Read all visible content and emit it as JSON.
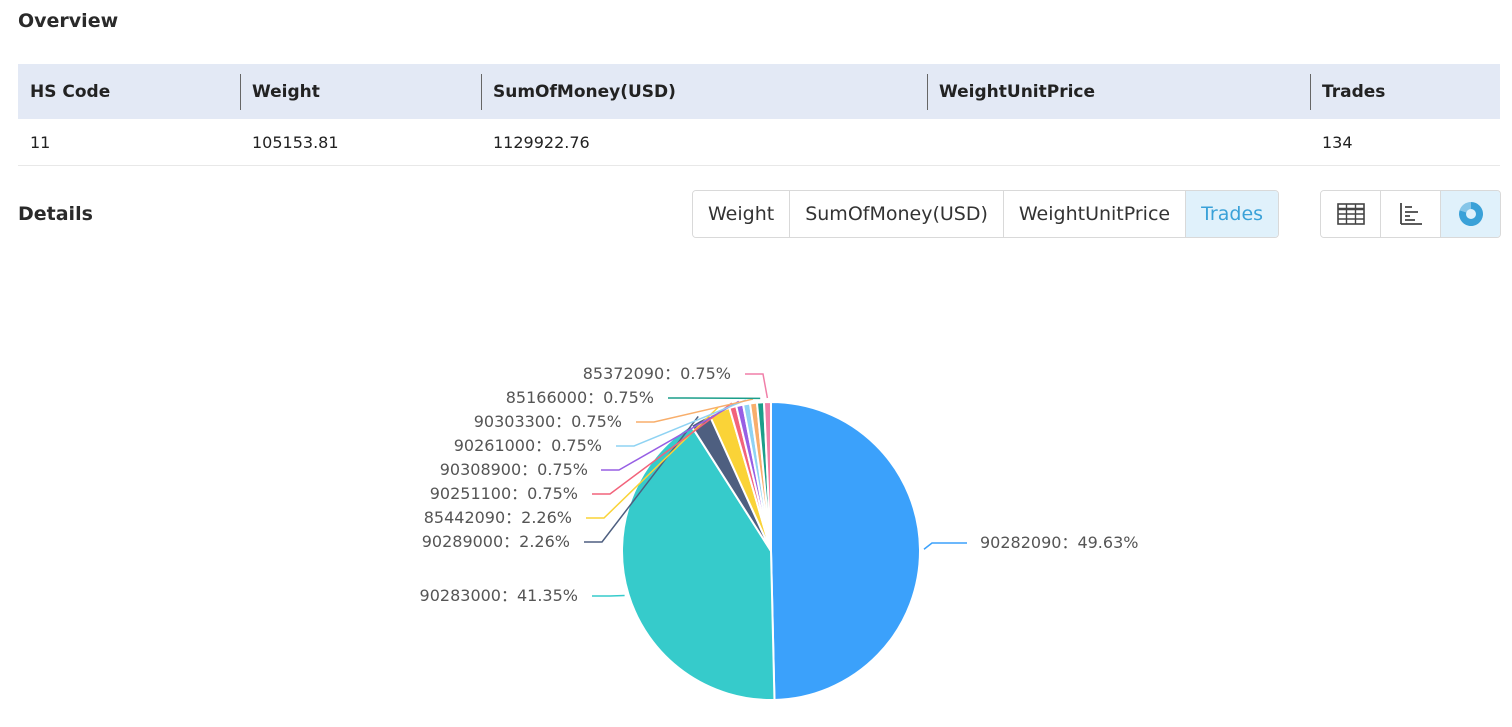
{
  "overview": {
    "title": "Overview",
    "columns": [
      "HS Code",
      "Weight",
      "SumOfMoney(USD)",
      "WeightUnitPrice",
      "Trades"
    ],
    "row": [
      "11",
      "105153.81",
      "1129922.76",
      "",
      "134"
    ]
  },
  "details": {
    "title": "Details",
    "metric_tabs": [
      "Weight",
      "SumOfMoney(USD)",
      "WeightUnitPrice",
      "Trades"
    ],
    "active_tab": "Trades",
    "view_icons": [
      "table-icon",
      "bar-chart-icon",
      "pie-chart-icon"
    ],
    "active_view": "pie-chart-icon"
  },
  "colors": {
    "header_bg": "#e3e9f5",
    "accent": "#3aa1d8"
  },
  "chart_data": {
    "type": "pie",
    "label_separator": "：",
    "slices": [
      {
        "label": "90282090",
        "value": 49.63,
        "display": "49.63%",
        "color": "#3ba1fb"
      },
      {
        "label": "90283000",
        "value": 41.35,
        "display": "41.35%",
        "color": "#36cbcb"
      },
      {
        "label": "90289000",
        "value": 2.26,
        "display": "2.26%",
        "color": "#4e5f80"
      },
      {
        "label": "85442090",
        "value": 2.26,
        "display": "2.26%",
        "color": "#fad337"
      },
      {
        "label": "90251100",
        "value": 0.75,
        "display": "0.75%",
        "color": "#f2637b"
      },
      {
        "label": "90308900",
        "value": 0.75,
        "display": "0.75%",
        "color": "#975fe4"
      },
      {
        "label": "90261000",
        "value": 0.75,
        "display": "0.75%",
        "color": "#8fd3f3"
      },
      {
        "label": "90303300",
        "value": 0.75,
        "display": "0.75%",
        "color": "#f8ae6b"
      },
      {
        "label": "85166000",
        "value": 0.75,
        "display": "0.75%",
        "color": "#1b9e8a"
      },
      {
        "label": "85372090",
        "value": 0.75,
        "display": "0.75%",
        "color": "#f07fa8"
      }
    ]
  }
}
